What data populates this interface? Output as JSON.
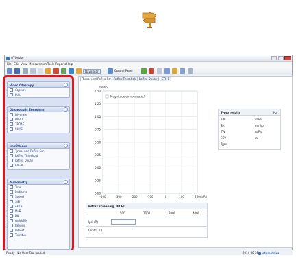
{
  "window": {
    "title": "OTOsuite"
  },
  "menu": [
    "File",
    "Edit",
    "View",
    "Measurement",
    "Tools",
    "Reports",
    "Help"
  ],
  "toolbar": {
    "navigator_label": "Navigator",
    "control_panel_label": "Control Panel"
  },
  "tabs": [
    "Tymp. and Reflex Scr.",
    "Reflex Threshold",
    "Reflex Decay",
    "ETF-P"
  ],
  "sidebar": {
    "panels": [
      {
        "title": "Video Otoscopy",
        "items": [
          "Capture",
          "Edit"
        ]
      },
      {
        "title": "Otoacoustic Emissions",
        "items": [
          "DP-gram",
          "DP-IO",
          "TEOAE",
          "SOAE"
        ]
      },
      {
        "title": "Immittance",
        "items": [
          "Tymp. and Reflex Scr.",
          "Reflex Threshold",
          "Reflex Decay",
          "ETF-P"
        ]
      },
      {
        "title": "Audiometry",
        "items": [
          "Tone",
          "Pediatric",
          "Speech",
          "SISI",
          "ABLB",
          "MLD",
          "DLI",
          "QuickSIN",
          "Bekesy",
          "LPbest",
          "Tinnitus"
        ]
      }
    ]
  },
  "chart_data": {
    "type": "line",
    "ylabel": "mmho",
    "yticks": [
      "1.50",
      "1.25",
      "1.00",
      "0.75",
      "0.50",
      "0.25",
      "0.00",
      "-0.25",
      "-0.50"
    ],
    "xticks": [
      "-400",
      "-300",
      "-200",
      "-100",
      "0",
      "100",
      "200"
    ],
    "xunit": "daPa",
    "ylim": [
      -0.5,
      1.5
    ],
    "xlim": [
      -400,
      200
    ],
    "checkbox_label": "Magnitude compensated",
    "series": []
  },
  "tymp_results": {
    "title": "Tymp results",
    "ear": "Hz",
    "rows": [
      {
        "label": "TPP",
        "unit": "daPa"
      },
      {
        "label": "SA",
        "unit": "mmho"
      },
      {
        "label": "TW",
        "unit": "daPa"
      },
      {
        "label": "ECV",
        "unit": "ml"
      },
      {
        "label": "Type",
        "unit": ""
      }
    ]
  },
  "reflex": {
    "title": "Reflex screening, dB HL",
    "freqs": [
      "500",
      "1000",
      "2000",
      "4000"
    ],
    "rows": [
      "Ipsi (R)",
      "Contra (L)"
    ]
  },
  "status": {
    "left": "Ready - No User Tool loaded",
    "date": "2014-08-25",
    "brand": "otometrics"
  },
  "colors": {
    "highlight": "#e0161b",
    "accent": "#1d3f7a"
  }
}
